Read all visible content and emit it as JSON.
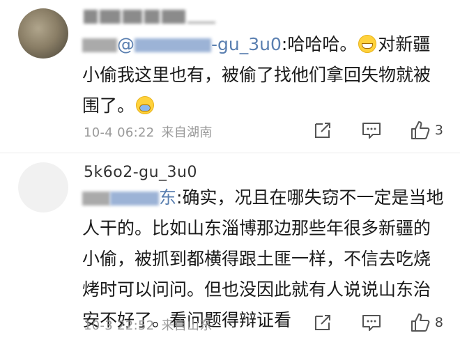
{
  "comments": [
    {
      "username": "",
      "mention": "@",
      "mention_tail": "-gu_3u0",
      "text_after": ":哈哈哈。",
      "text_main": "对新疆小偷我这里也有，被偷了找他们拿回失物就被围了。",
      "timestamp": "10-4 06:22",
      "source": "来自湖南",
      "likes": "3"
    },
    {
      "username": "5k6o2-gu_3u0",
      "mention_tail": "东",
      "text_after": ":确实，况且在哪失窃不一定是当地人干的。比如山东淄博那边那些年很多新疆的小偷，被抓到都横得跟土匪一样，不信去吃烧烤时可以问问。但也没因此就有人说说山东治安不好了。看问题得辩证看",
      "timestamp": "10-3 22:52",
      "source": "来自山东",
      "likes": "8"
    }
  ],
  "icons": {
    "share": "share-icon",
    "comment": "comment-icon",
    "like": "thumbs-up-icon"
  }
}
